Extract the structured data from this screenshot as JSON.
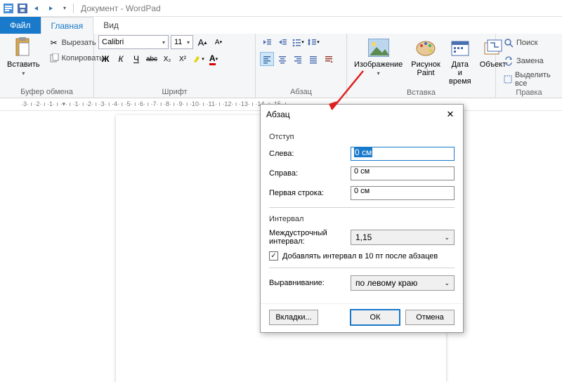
{
  "title": "Документ - WordPad",
  "tabs": {
    "file": "Файл",
    "home": "Главная",
    "view": "Вид"
  },
  "clipboard": {
    "paste": "Вставить",
    "cut": "Вырезать",
    "copy": "Копировать",
    "group": "Буфер обмена"
  },
  "font": {
    "name": "Calibri",
    "size": "11",
    "group": "Шрифт"
  },
  "paragraph": {
    "group": "Абзац"
  },
  "insert": {
    "image": "Изображение",
    "paint": "Рисунок Paint",
    "datetime": "Дата и время",
    "object": "Объект",
    "group": "Вставка"
  },
  "edit": {
    "find": "Поиск",
    "replace": "Замена",
    "selectall": "Выделить все",
    "group": "Правка"
  },
  "ruler": "·3· ı ·2· ı ·1· ı ·▾· ı ·1· ı ·2· ı ·3· ı ·4· ı ·5· ı ·6· ı ·7· ı ·8· ı ·9· ı ·10· ı ·11· ı ·12· ı ·13· ı ·14· ı ·15· ı",
  "dialog": {
    "title": "Абзац",
    "indent": {
      "header": "Отступ",
      "left_label": "Слева:",
      "left_value": "0 см",
      "right_label": "Справа:",
      "right_value": "0 см",
      "first_label": "Первая строка:",
      "first_value": "0 см"
    },
    "interval": {
      "header": "Интервал",
      "linespacing_label": "Междустрочный интервал:",
      "linespacing_value": "1,15",
      "add_space_label": "Добавлять интервал в 10 пт после абзацев"
    },
    "align": {
      "label": "Выравнивание:",
      "value": "по левому краю"
    },
    "buttons": {
      "tabs": "Вкладки...",
      "ok": "ОК",
      "cancel": "Отмена"
    }
  }
}
